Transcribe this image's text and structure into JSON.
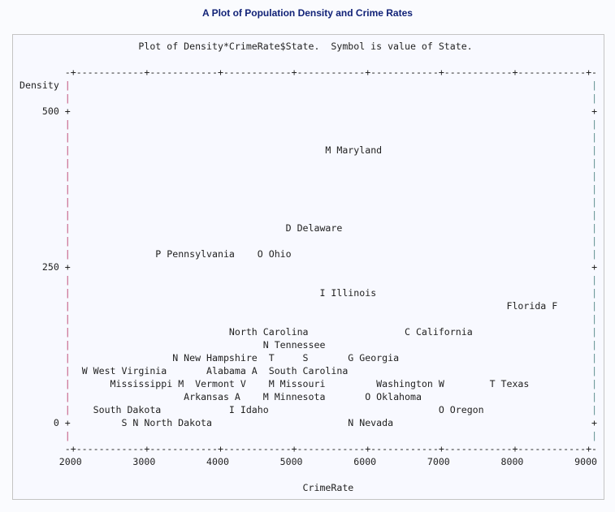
{
  "title": "A Plot of Population Density and Crime Rates",
  "chart_data": {
    "type": "scatter",
    "title": "A Plot of Population Density and Crime Rates",
    "subtitle": "Plot of Density*CrimeRate$State.  Symbol is value of State.",
    "xlabel": "CrimeRate",
    "ylabel": "Density",
    "xlim": [
      2000,
      9000
    ],
    "ylim": [
      0,
      500
    ],
    "x_ticks": [
      "2000",
      "3000",
      "4000",
      "5000",
      "6000",
      "7000",
      "8000",
      "9000"
    ],
    "y_ticks": [
      "0",
      "250",
      "500"
    ],
    "grid": false,
    "style": "line-printer text plot"
  },
  "plot_lines": [
    {
      "text": "                     Plot of Density*CrimeRate$State.  Symbol is value of State.",
      "right": ""
    },
    {
      "text": "",
      "right": ""
    },
    {
      "text": "        -+------------+------------+------------+------------+------------+------------+------------+-",
      "right": ""
    },
    {
      "text": "Density |",
      "right": "|"
    },
    {
      "text": "        |",
      "right": "|"
    },
    {
      "text": "    500 +",
      "right": "+"
    },
    {
      "text": "        |",
      "right": "|"
    },
    {
      "text": "        |",
      "right": "|"
    },
    {
      "text": "        |                                             M Maryland",
      "right": "|"
    },
    {
      "text": "        |",
      "right": "|"
    },
    {
      "text": "        |",
      "right": "|"
    },
    {
      "text": "        |",
      "right": "|"
    },
    {
      "text": "        |",
      "right": "|"
    },
    {
      "text": "        |",
      "right": "|"
    },
    {
      "text": "        |                                      D Delaware",
      "right": "|"
    },
    {
      "text": "        |",
      "right": "|"
    },
    {
      "text": "        |               P Pennsylvania    O Ohio",
      "right": "|"
    },
    {
      "text": "    250 +",
      "right": "+"
    },
    {
      "text": "        |",
      "right": "|"
    },
    {
      "text": "        |                                            I Illinois",
      "right": "|"
    },
    {
      "text": "        |                                                                             Florida F",
      "right": "|"
    },
    {
      "text": "        |",
      "right": "|"
    },
    {
      "text": "        |                            North Carolina                 C California",
      "right": "|"
    },
    {
      "text": "        |                                  N Tennessee",
      "right": "|"
    },
    {
      "text": "        |                  N New Hampshire  T     S       G Georgia",
      "right": "|"
    },
    {
      "text": "        |  W West Virginia       Alabama A  South Carolina",
      "right": "|"
    },
    {
      "text": "        |       Mississippi M  Vermont V    M Missouri         Washington W        T Texas",
      "right": "|"
    },
    {
      "text": "        |                    Arkansas A    M Minnesota       O Oklahoma",
      "right": "|"
    },
    {
      "text": "        |    South Dakota            I Idaho                              O Oregon",
      "right": "|"
    },
    {
      "text": "      0 +         S N North Dakota                        N Nevada",
      "right": "+"
    },
    {
      "text": "        |",
      "right": "|"
    },
    {
      "text": "        -+------------+------------+------------+------------+------------+------------+------------+-",
      "right": ""
    },
    {
      "text": "       2000         3000         4000         5000         6000         7000         8000         9000",
      "right": ""
    },
    {
      "text": "",
      "right": ""
    },
    {
      "text": "                                                  CrimeRate",
      "right": ""
    }
  ]
}
